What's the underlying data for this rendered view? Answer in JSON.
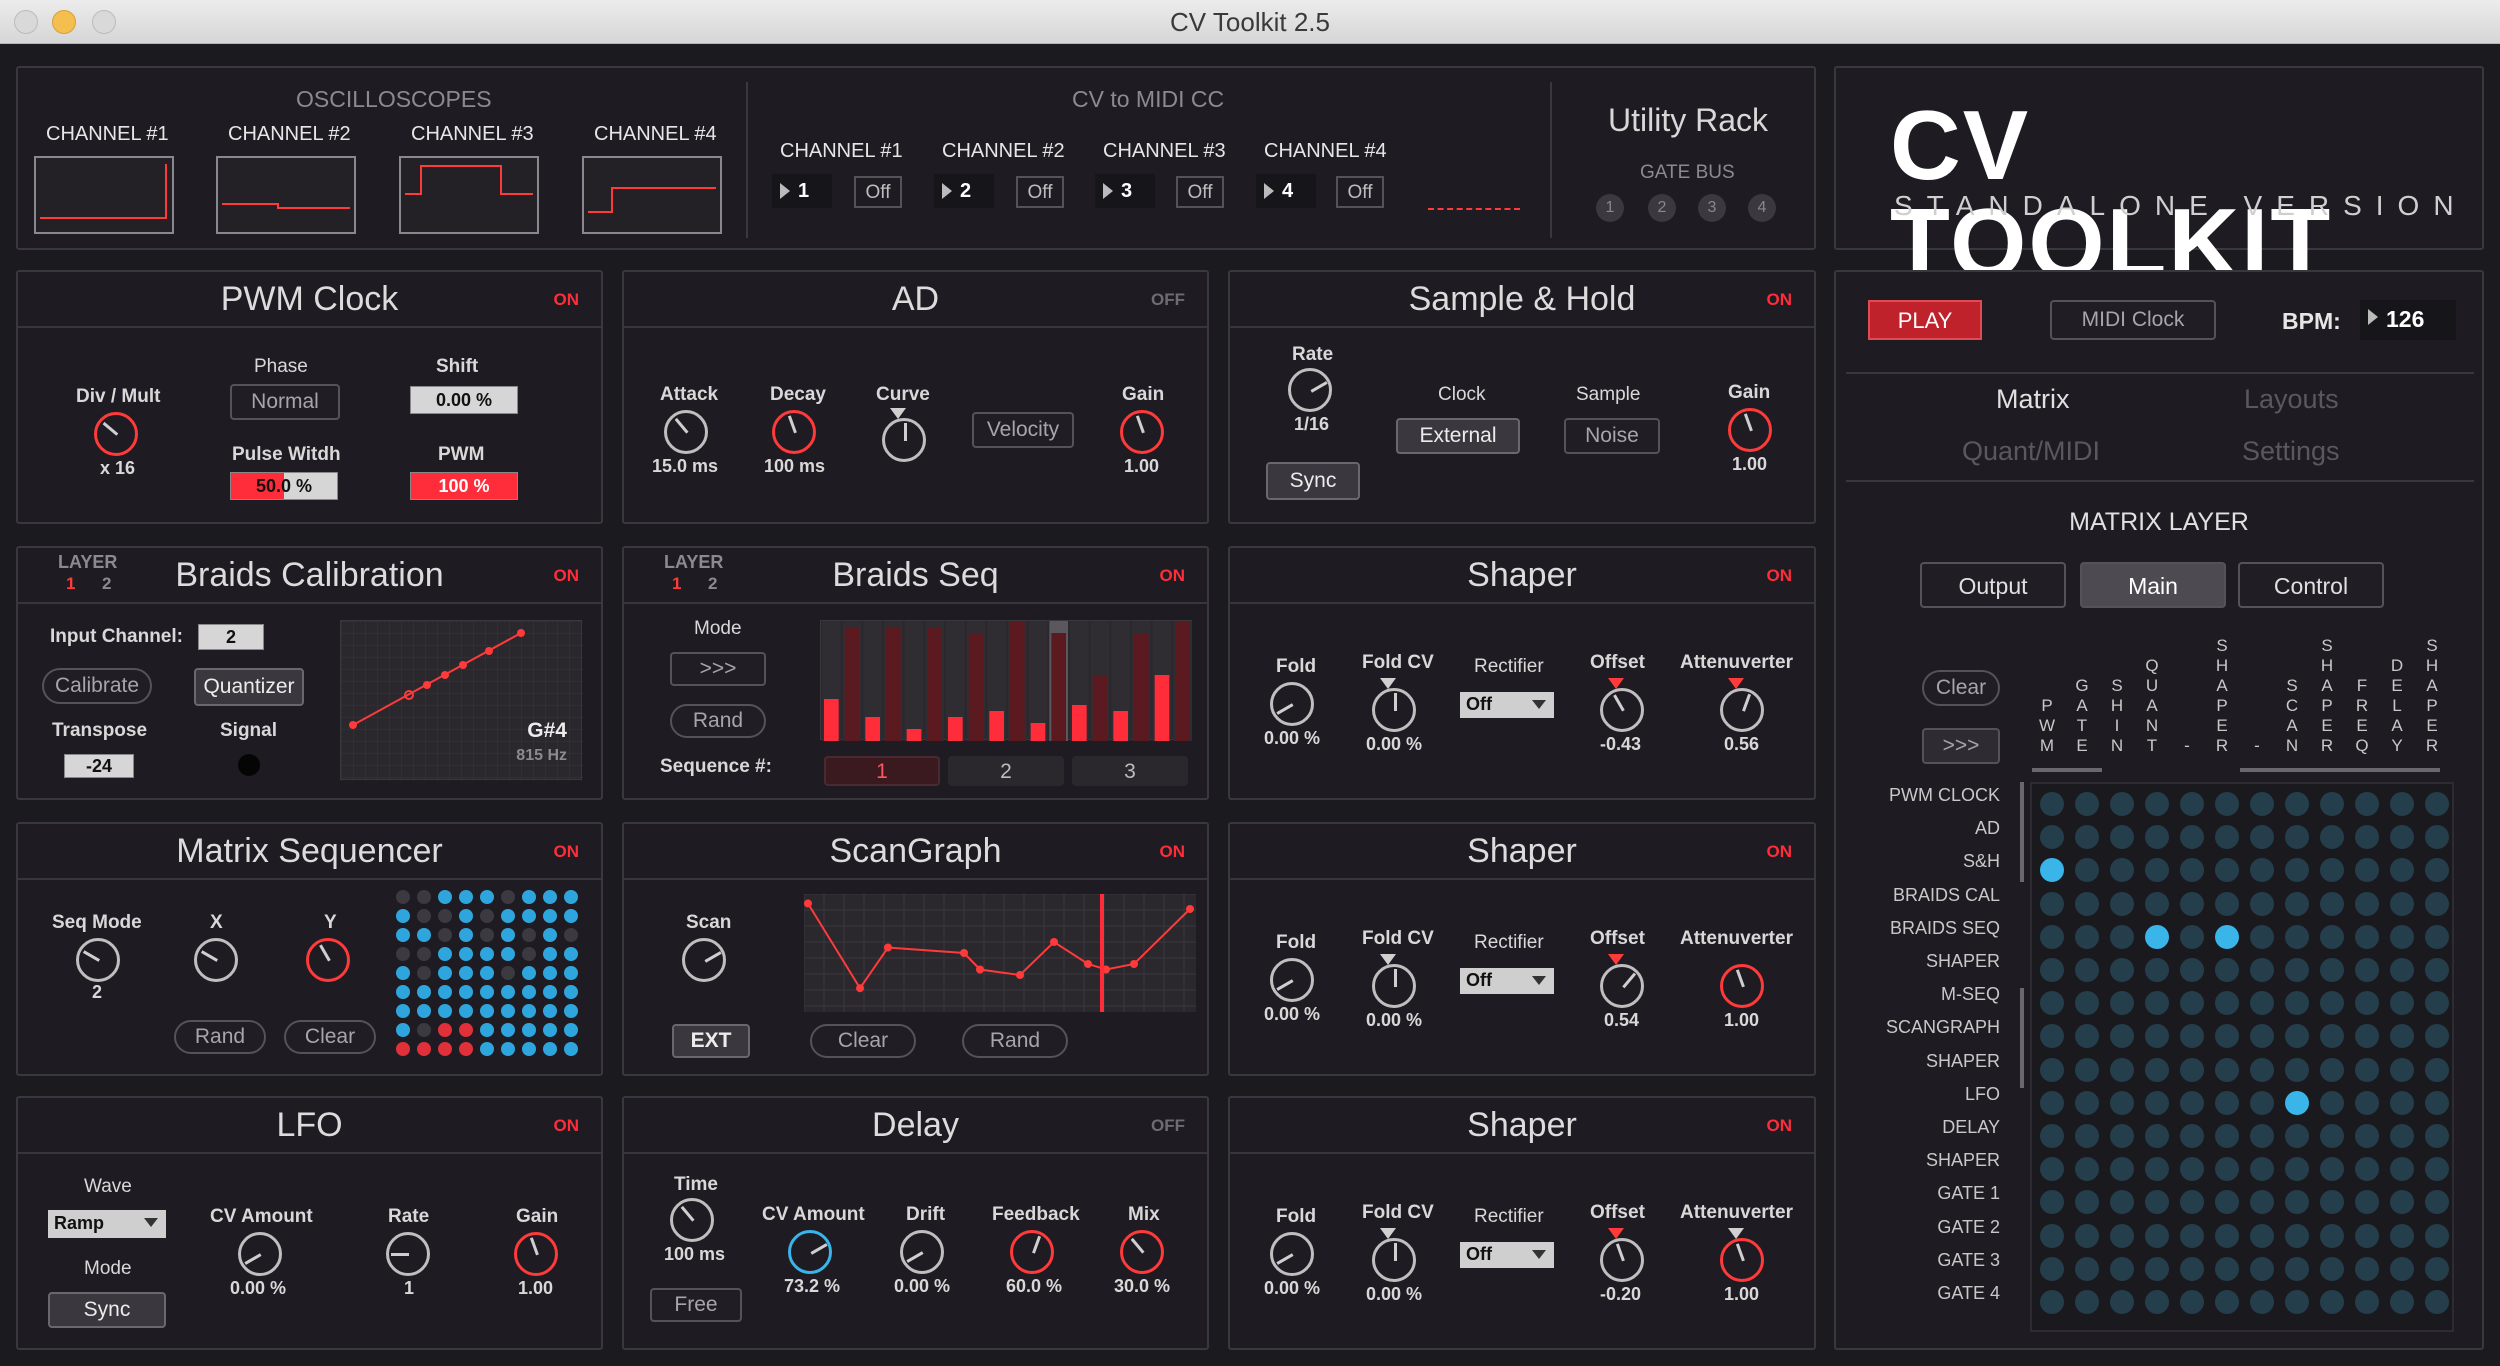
{
  "window": {
    "title": "CV Toolkit 2.5"
  },
  "oscilloscopes": {
    "heading": "OSCILLOSCOPES",
    "channels": [
      "CHANNEL #1",
      "CHANNEL #2",
      "CHANNEL #3",
      "CHANNEL #4"
    ]
  },
  "cv_to_midi": {
    "heading": "CV to MIDI CC",
    "channels": [
      {
        "label": "CHANNEL #1",
        "num": "1",
        "state": "Off"
      },
      {
        "label": "CHANNEL #2",
        "num": "2",
        "state": "Off"
      },
      {
        "label": "CHANNEL #3",
        "num": "3",
        "state": "Off"
      },
      {
        "label": "CHANNEL #4",
        "num": "4",
        "state": "Off"
      }
    ]
  },
  "utility": {
    "heading": "Utility Rack",
    "gate_bus": "GATE BUS",
    "gates": [
      "1",
      "2",
      "3",
      "4"
    ]
  },
  "logo": {
    "title": "CV TOOLKIT",
    "subtitle": "STANDALONE VERSION"
  },
  "pwm_clock": {
    "title": "PWM Clock",
    "status": "ON",
    "div_label": "Div / Mult",
    "div_value": "x 16",
    "phase_label": "Phase",
    "phase_value": "Normal",
    "shift_label": "Shift",
    "shift_value": "0.00 %",
    "pw_label": "Pulse Witdh",
    "pw_value": "50.0 %",
    "pw_fill": 0.5,
    "pwm_label": "PWM",
    "pwm_value": "100 %"
  },
  "ad": {
    "title": "AD",
    "status": "OFF",
    "attack_label": "Attack",
    "attack_value": "15.0 ms",
    "decay_label": "Decay",
    "decay_value": "100 ms",
    "curve_label": "Curve",
    "velocity": "Velocity",
    "gain_label": "Gain",
    "gain_value": "1.00"
  },
  "sample_hold": {
    "title": "Sample & Hold",
    "status": "ON",
    "rate_label": "Rate",
    "rate_value": "1/16",
    "sync": "Sync",
    "clock_label": "Clock",
    "clock_value": "External",
    "sample_label": "Sample",
    "sample_value": "Noise",
    "gain_label": "Gain",
    "gain_value": "1.00"
  },
  "braids_cal": {
    "title": "Braids Calibration",
    "status": "ON",
    "layer": "LAYER",
    "layers": [
      "1",
      "2"
    ],
    "input_label": "Input Channel:",
    "input_value": "2",
    "calibrate": "Calibrate",
    "quantizer": "Quantizer",
    "transpose_label": "Transpose",
    "transpose_value": "-24",
    "signal_label": "Signal",
    "note": "G#4",
    "freq": "815 Hz"
  },
  "braids_seq": {
    "title": "Braids Seq",
    "status": "ON",
    "layer": "LAYER",
    "layers": [
      "1",
      "2"
    ],
    "mode_label": "Mode",
    "mode_value": ">>>",
    "rand": "Rand",
    "seq_label": "Sequence #:",
    "seqs": [
      "1",
      "2",
      "3"
    ],
    "bars": [
      0.35,
      0.95,
      0.2,
      0.95,
      0.1,
      0.95,
      0.2,
      0.9,
      0.25,
      1.0,
      0.15,
      0.9,
      0.3,
      0.55,
      0.25,
      0.9,
      0.55,
      1.0
    ]
  },
  "matrix_seq": {
    "title": "Matrix Sequencer",
    "status": "ON",
    "seqmode_label": "Seq Mode",
    "seqmode_value": "2",
    "x_label": "X",
    "y_label": "Y",
    "rand": "Rand",
    "clear": "Clear"
  },
  "scangraph": {
    "title": "ScanGraph",
    "status": "ON",
    "scan_label": "Scan",
    "ext": "EXT",
    "clear": "Clear",
    "rand": "Rand",
    "points": [
      0.95,
      0.18,
      0.55,
      0.5,
      0.35,
      0.3,
      0.6,
      0.4,
      0.35,
      0.4,
      0.9
    ]
  },
  "lfo": {
    "title": "LFO",
    "status": "ON",
    "wave_label": "Wave",
    "wave_value": "Ramp",
    "mode_label": "Mode",
    "mode_value": "Sync",
    "cv_label": "CV Amount",
    "cv_value": "0.00 %",
    "rate_label": "Rate",
    "rate_value": "1",
    "gain_label": "Gain",
    "gain_value": "1.00"
  },
  "delay": {
    "title": "Delay",
    "status": "OFF",
    "time_label": "Time",
    "time_value": "100 ms",
    "free": "Free",
    "cv_label": "CV Amount",
    "cv_value": "73.2 %",
    "drift_label": "Drift",
    "drift_value": "0.00 %",
    "fb_label": "Feedback",
    "fb_value": "60.0 %",
    "mix_label": "Mix",
    "mix_value": "30.0 %"
  },
  "shapers": [
    {
      "title": "Shaper",
      "status": "ON",
      "fold": "Fold",
      "fold_value": "0.00 %",
      "foldcv": "Fold CV",
      "foldcv_value": "0.00 %",
      "rectifier": "Rectifier",
      "rect_value": "Off",
      "offset": "Offset",
      "offset_value": "-0.43",
      "atten": "Attenuverter",
      "atten_value": "0.56"
    },
    {
      "title": "Shaper",
      "status": "ON",
      "fold": "Fold",
      "fold_value": "0.00 %",
      "foldcv": "Fold CV",
      "foldcv_value": "0.00 %",
      "rectifier": "Rectifier",
      "rect_value": "Off",
      "offset": "Offset",
      "offset_value": "0.54",
      "atten": "Attenuverter",
      "atten_value": "1.00"
    },
    {
      "title": "Shaper",
      "status": "ON",
      "fold": "Fold",
      "fold_value": "0.00 %",
      "foldcv": "Fold CV",
      "foldcv_value": "0.00 %",
      "rectifier": "Rectifier",
      "rect_value": "Off",
      "offset": "Offset",
      "offset_value": "-0.20",
      "atten": "Attenuverter",
      "atten_value": "1.00"
    }
  ],
  "transport": {
    "play": "PLAY",
    "midi_clock": "MIDI Clock",
    "bpm_label": "BPM:",
    "bpm_value": "126"
  },
  "nav": {
    "tabs": [
      "Matrix",
      "Layouts",
      "Quant/MIDI",
      "Settings"
    ]
  },
  "matrix": {
    "heading": "MATRIX LAYER",
    "layers": [
      "Output",
      "Main",
      "Control"
    ],
    "clear": "Clear",
    "next": ">>>",
    "columns": [
      "PWM",
      "GATE",
      "SHIN",
      "QUANT",
      "-",
      "SHAPER",
      "-",
      "SCAN",
      "SHAPER",
      "FREQ",
      "DELAY",
      "SHAPER"
    ],
    "rows": [
      "PWM CLOCK",
      "AD",
      "S&H",
      "BRAIDS CAL",
      "BRAIDS SEQ",
      "SHAPER",
      "M-SEQ",
      "SCANGRAPH",
      "SHAPER",
      "LFO",
      "DELAY",
      "SHAPER",
      "GATE 1",
      "GATE 2",
      "GATE 3",
      "GATE 4"
    ],
    "active": [
      [
        2,
        0
      ],
      [
        4,
        3
      ],
      [
        4,
        5
      ],
      [
        9,
        7
      ]
    ]
  },
  "colors": {
    "accent_red": "#ff2d3a",
    "accent_blue": "#39b5ea",
    "panel": "#1e1c22"
  }
}
